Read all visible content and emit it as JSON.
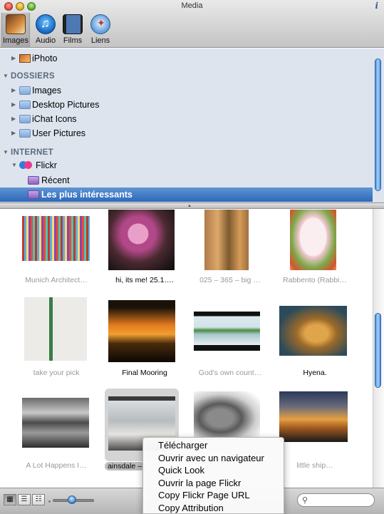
{
  "window": {
    "title": "Media",
    "info_glyph": "i"
  },
  "toolbar": {
    "tabs": [
      {
        "label": "Images",
        "icon": "images-icon"
      },
      {
        "label": "Audio",
        "icon": "audio-icon"
      },
      {
        "label": "Films",
        "icon": "films-icon"
      },
      {
        "label": "Liens",
        "icon": "liens-icon"
      }
    ],
    "active_tab": "Images"
  },
  "sources": {
    "iphoto": "iPhoto",
    "dossiers_header": "DOSSIERS",
    "folders": [
      "Images",
      "Desktop Pictures",
      "iChat Icons",
      "User Pictures"
    ],
    "internet_header": "INTERNET",
    "flickr": "Flickr",
    "recent": "Récent",
    "selected": "Les plus intéressants"
  },
  "photos": [
    {
      "caption": "Munich Architect…"
    },
    {
      "caption": "hi, its me!  25.1…."
    },
    {
      "caption": "025 – 365 – big …"
    },
    {
      "caption": "Rabbento (Rabbi…"
    },
    {
      "caption": "take your pick"
    },
    {
      "caption": "Final Mooring"
    },
    {
      "caption": "God's own count…"
    },
    {
      "caption": "Hyena."
    },
    {
      "caption": "A Lot Happens I…"
    },
    {
      "caption": "ainsdale –"
    },
    {
      "caption": ""
    },
    {
      "caption": "little ship…"
    }
  ],
  "context_menu": {
    "items": [
      "Télécharger",
      "Ouvrir avec un navigateur",
      "Quick Look",
      "Ouvrir la page Flickr",
      "Copy Flickr Page URL",
      "Copy Attribution"
    ]
  },
  "bottombar": {
    "search_value": "",
    "search_glyph": "⚲"
  },
  "colors": {
    "selection": "#2d68b8",
    "source_bg": "#dde4ee",
    "scroll_thumb": "#4a8ed8"
  }
}
